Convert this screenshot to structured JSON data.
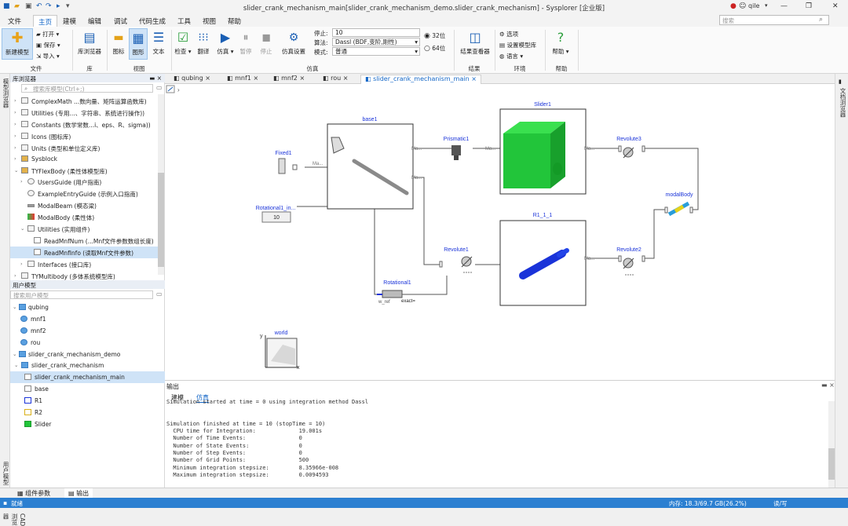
{
  "window": {
    "title": "slider_crank_mechanism_main[slider_crank_mechanism_demo.slider_crank_mechanism] - Sysplorer [企业版]",
    "user": "qile"
  },
  "menu": [
    "文件",
    "主页",
    "建模",
    "编辑",
    "调试",
    "代码生成",
    "工具",
    "视图",
    "帮助"
  ],
  "search": {
    "placeholder": "搜索"
  },
  "ribbon": {
    "new_model": "新建模型",
    "open": "打开",
    "save": "保存",
    "import": "导入",
    "group_file": "文件",
    "lib_browser": "库浏览器",
    "group_lib": "库",
    "icon": "图标",
    "diagram": "图形",
    "text": "文本",
    "group_view": "视图",
    "check": "检查",
    "translate": "翻译",
    "simulate": "仿真",
    "pause": "暂停",
    "stop": "停止",
    "sim_settings": "仿真设置",
    "stop_label": "停止:",
    "stop_value": "10",
    "algo_label": "算法:",
    "algo_value": "Dassl (BDF,变阶,刚性)",
    "mode_label": "模式:",
    "mode_value": "普通",
    "bit32": "32位",
    "bit64": "64位",
    "group_sim": "仿真",
    "result_viewer": "结果查看器",
    "group_result": "结果",
    "options": "选项",
    "set_model_lib": "设置模型库",
    "language": "语言",
    "group_env": "环境",
    "help": "帮助",
    "group_help": "帮助"
  },
  "left_strip": {
    "lib": "模型浏览器",
    "user": "用户模型",
    "cad": "CAD 浏览器"
  },
  "lib_panel": {
    "title": "库浏览器",
    "search_placeholder": "搜索库模型(Ctrl+;)",
    "items": [
      "ComplexMath ...数向量、矩阵运算函数库)",
      "Utilities (专用...、字符串、系统进行操作))",
      "Constants (数学常数...i、eps、R、sigma))",
      "Icons (图标库)",
      "Units (类型和单位定义库)",
      "Sysblock",
      "TYFlexBody (柔性体模型库)",
      "UsersGuide (用户指南)",
      "ExampleEntryGuide (示例入口指南)",
      "ModalBeam (模态梁)",
      "ModalBody (柔性体)",
      "Utilities (实用组件)",
      "ReadMnfNum (...Mnf文件参数数组长度)",
      "ReadMnfInfo (读取Mnf文件参数)",
      "Interfaces (接口库)",
      "TYMultibody (多体系统模型库)"
    ]
  },
  "user_panel": {
    "title": "用户模型",
    "search_placeholder": "搜索用户模型",
    "items": [
      "qubing",
      "mnf1",
      "mnf2",
      "rou",
      "slider_crank_mechanism_demo",
      "slider_crank_mechanism",
      "slider_crank_mechanism_main",
      "base",
      "R1",
      "R2",
      "Slider"
    ]
  },
  "tabs": [
    "qubing",
    "mnf1",
    "mnf2",
    "rou",
    "slider_crank_mechanism_main"
  ],
  "diagram": {
    "components": {
      "base": "base1",
      "fixed": "Fixed1",
      "prismatic": "Prismatic1",
      "slider": "Slider1",
      "revolute3": "Revolute3",
      "modal": "modalBody",
      "rot_in": "Rotational1_in...",
      "rot_in_value": "10",
      "revolute1": "Revolute1",
      "r1": "R1_1_1",
      "revolute2": "Revolute2",
      "rotational": "Rotational1",
      "wref": "w_ref",
      "exact": "exact=",
      "world": "world",
      "axis_y": "y",
      "axis_x": "x"
    },
    "port_labels": {
      "ma": "Ma..."
    }
  },
  "output": {
    "title": "输出",
    "tab_model": "建模",
    "tab_sim": "仿真",
    "lines": [
      "Simulation started at time = 0 using integration method Dassl",
      "",
      "",
      "Simulation finished at time = 10 (stopTime = 10)",
      "  CPU time for Integration:             19.001s",
      "  Number of Time Events:                0",
      "  Number of State Events:               0",
      "  Number of Step Events:                0",
      "  Number of Grid Points:                500",
      "  Minimum integration stepsize:         8.35966e-008",
      "  Maximum integration stepsize:         0.0094593"
    ]
  },
  "right_strip": {
    "doc": "文档浏览器"
  },
  "bottom_tabs": {
    "params": "组件参数",
    "output": "输出"
  },
  "status": {
    "ready": "就绪",
    "memory": "内存: 18.3/69.7 GB(26.2%)",
    "rw": "读/写"
  },
  "colors": {
    "accent": "#1467c7",
    "status": "#2b7fd1",
    "slider": "#22c53a",
    "r1": "#1a33d9"
  }
}
